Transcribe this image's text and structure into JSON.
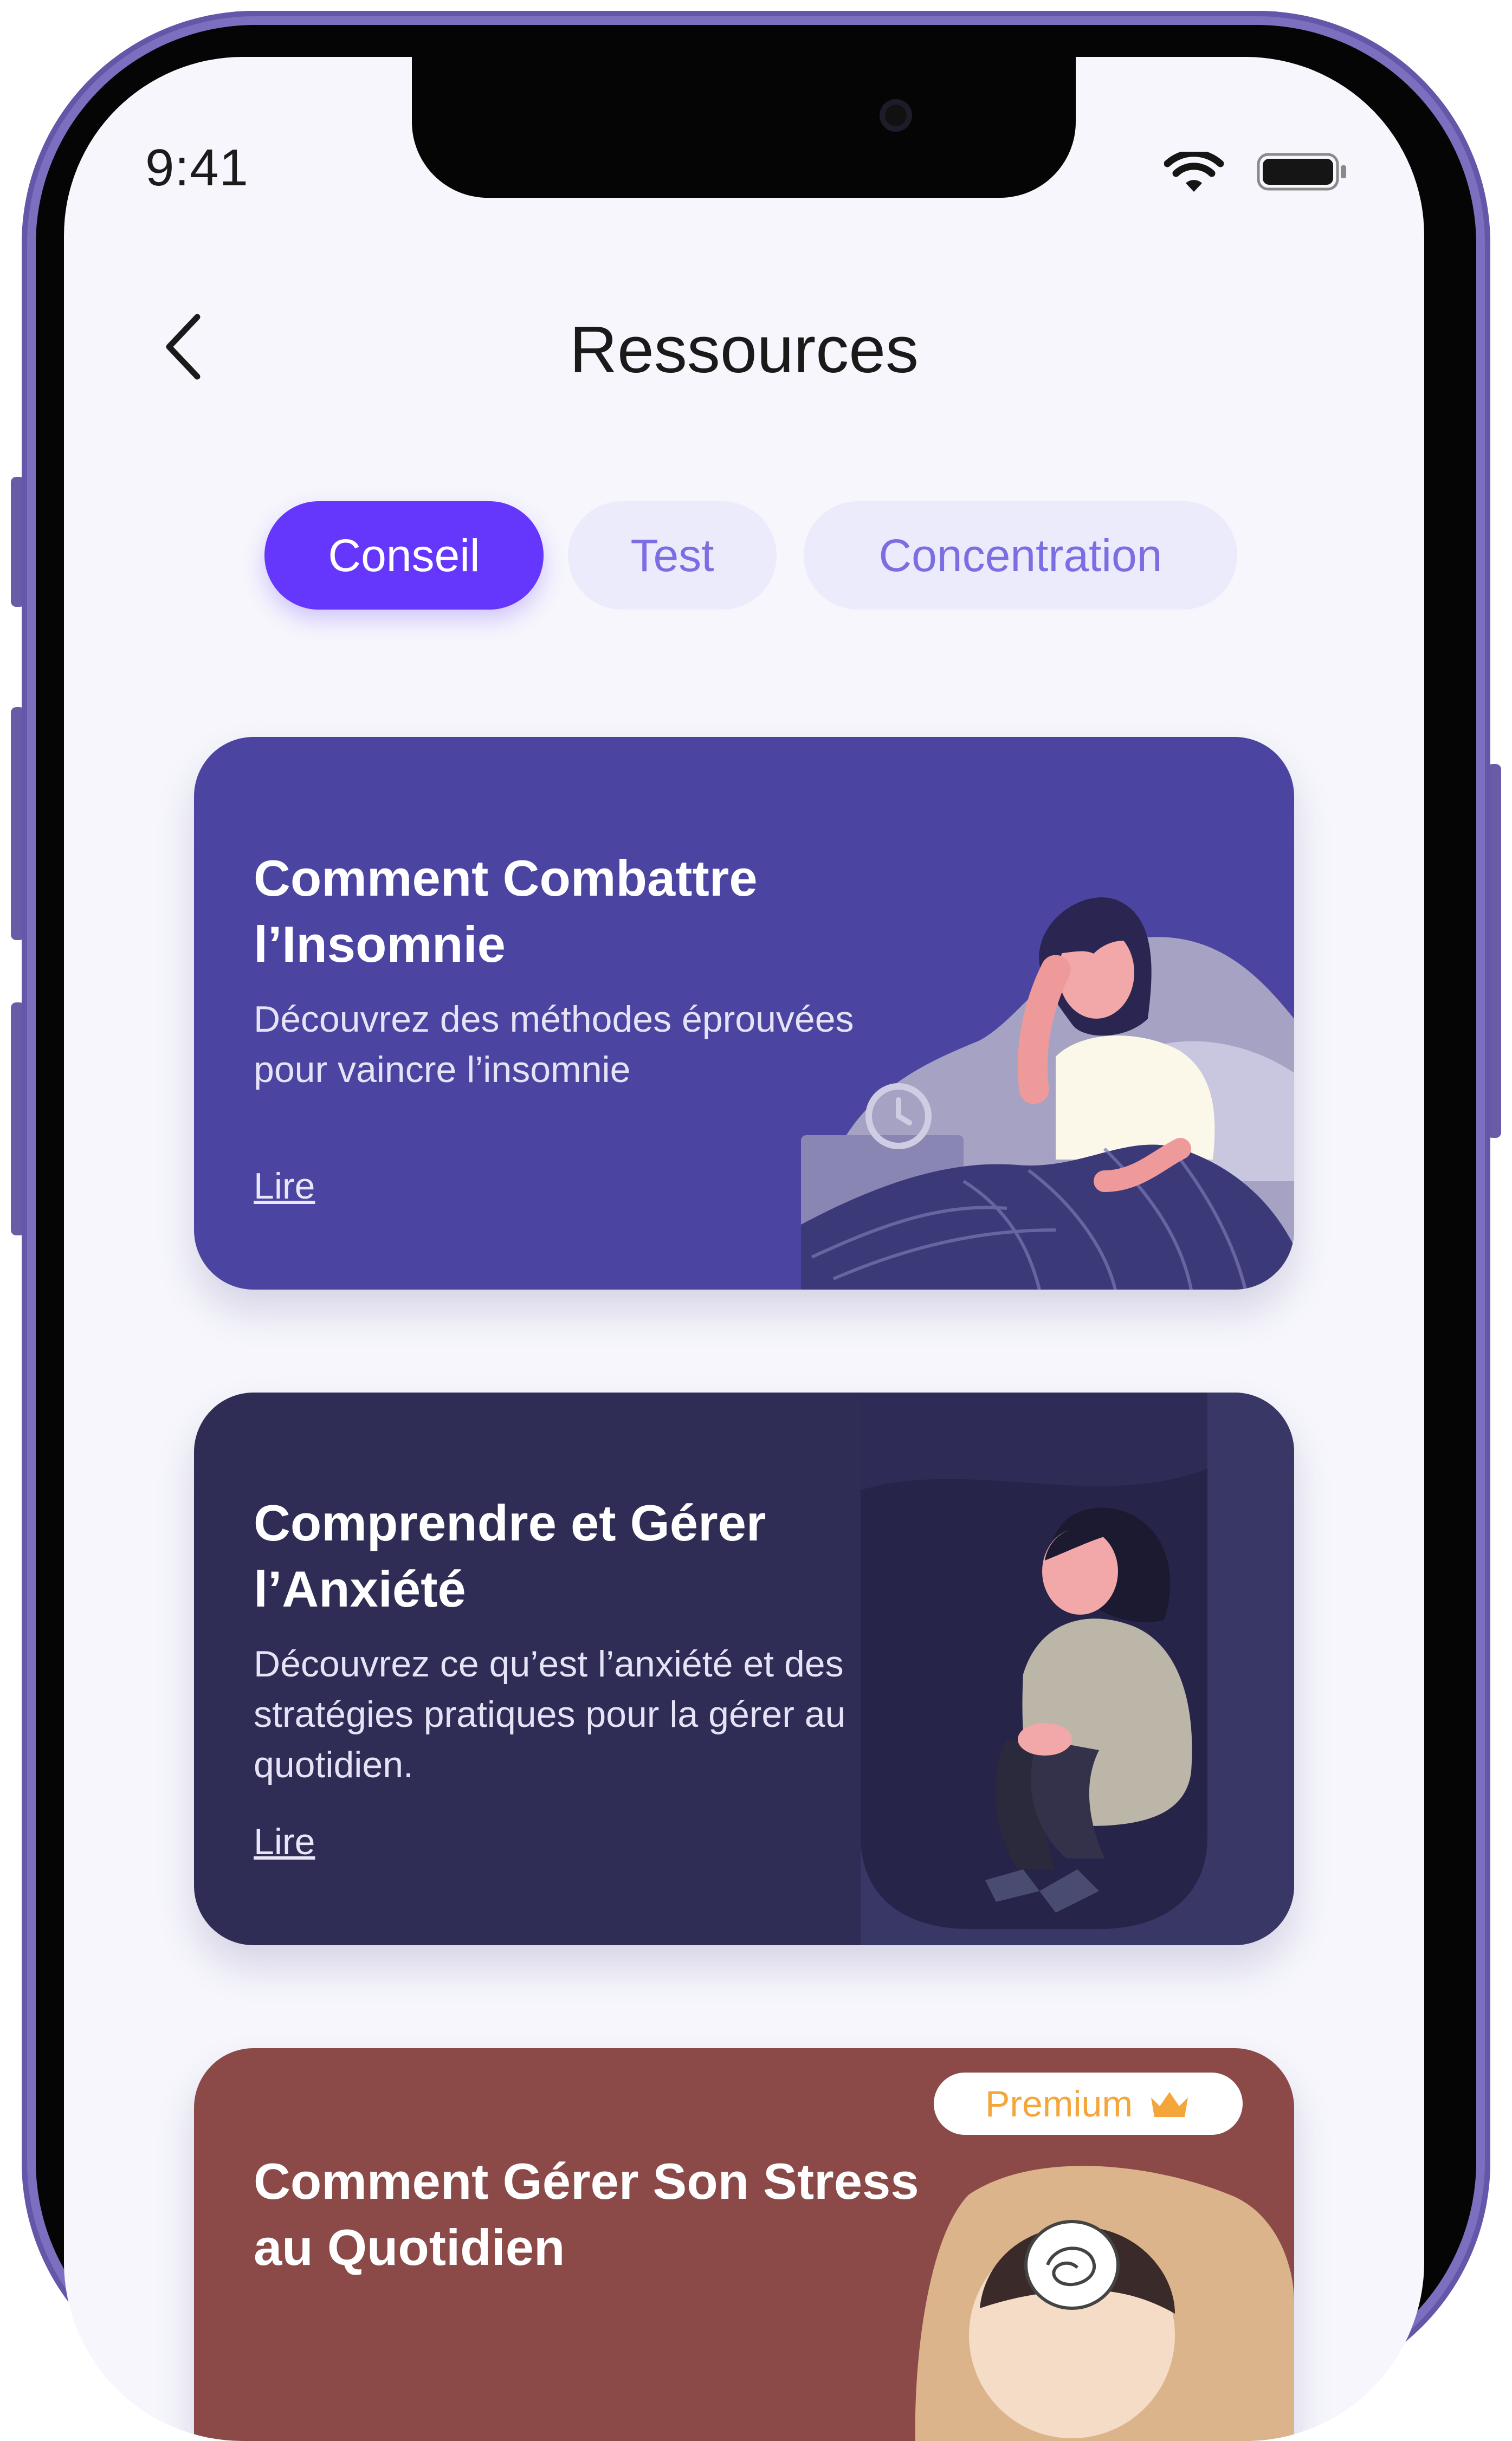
{
  "status_bar": {
    "time": "9:41",
    "wifi_icon": "wifi-icon",
    "battery_icon": "battery-icon"
  },
  "header": {
    "title": "Ressources",
    "back_icon": "chevron-left-icon"
  },
  "tabs": [
    {
      "label": "Conseil",
      "active": true
    },
    {
      "label": "Test",
      "active": false
    },
    {
      "label": "Concentration",
      "active": false
    }
  ],
  "cards": [
    {
      "title": "Comment Combattre l’Insomnie",
      "description": "Découvrez des méthodes éprouvées pour vaincre l’insomnie",
      "link": "Lire",
      "color": "#4b45a1"
    },
    {
      "title": "Comprendre et Gérer l’Anxiété",
      "description": "Découvrez ce qu’est l’anxiété et des stratégies pratiques pour la gérer au quotidien.",
      "link": "Lire",
      "color": "#2f2d56"
    },
    {
      "title": "Comment Gérer Son Stress au Quotidien",
      "badge": "Premium",
      "badge_icon": "crown-icon",
      "color": "#8b4a48"
    }
  ],
  "colors": {
    "accent": "#6536fb",
    "tab_inactive_bg": "#ecebfb",
    "tab_inactive_text": "#7b6ee3",
    "premium": "#f4a63a"
  }
}
